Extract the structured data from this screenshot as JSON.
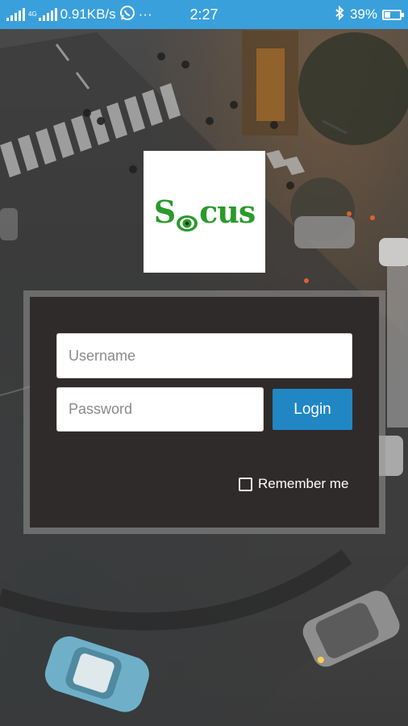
{
  "status_bar": {
    "network_type": "4G",
    "speed": "0.91KB/s",
    "more": "···",
    "time": "2:27",
    "battery_percent": "39%",
    "battery_level": 0.39,
    "icons": [
      "signal-icon",
      "signal-4g-icon",
      "whatsapp-icon",
      "more-icon",
      "bluetooth-icon",
      "battery-icon"
    ],
    "background_color": "#3aa0dc"
  },
  "logo": {
    "text_left": "S",
    "text_right": "cus",
    "icon": "eye-icon",
    "color": "#2a9a2a"
  },
  "login_form": {
    "username_placeholder": "Username",
    "username_value": "",
    "password_placeholder": "Password",
    "password_value": "",
    "login_label": "Login",
    "login_color": "#2087c4",
    "remember_label": "Remember me",
    "remember_checked": false
  }
}
